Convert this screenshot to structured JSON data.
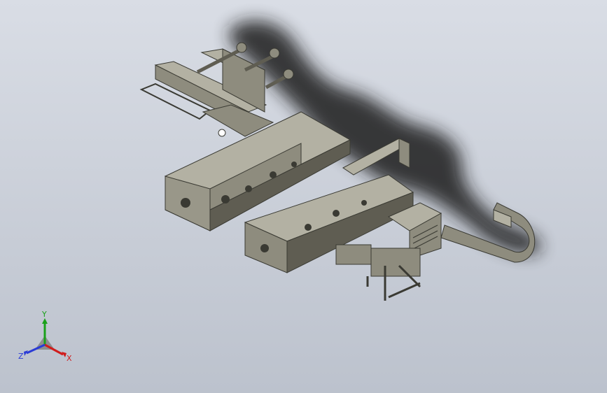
{
  "viewport": {
    "background_top": "#d9dde5",
    "background_bottom": "#bcc2cd"
  },
  "model": {
    "body_color": "#8e8c7e",
    "dark_color": "#5f5d52",
    "light_color": "#b3b1a3",
    "shadow_color": "#1c1c1c"
  },
  "triad": {
    "x_label": "X",
    "y_label": "Y",
    "z_label": "Z",
    "x_color": "#d01c1c",
    "y_color": "#1aa11a",
    "z_color": "#2a3bd6"
  }
}
